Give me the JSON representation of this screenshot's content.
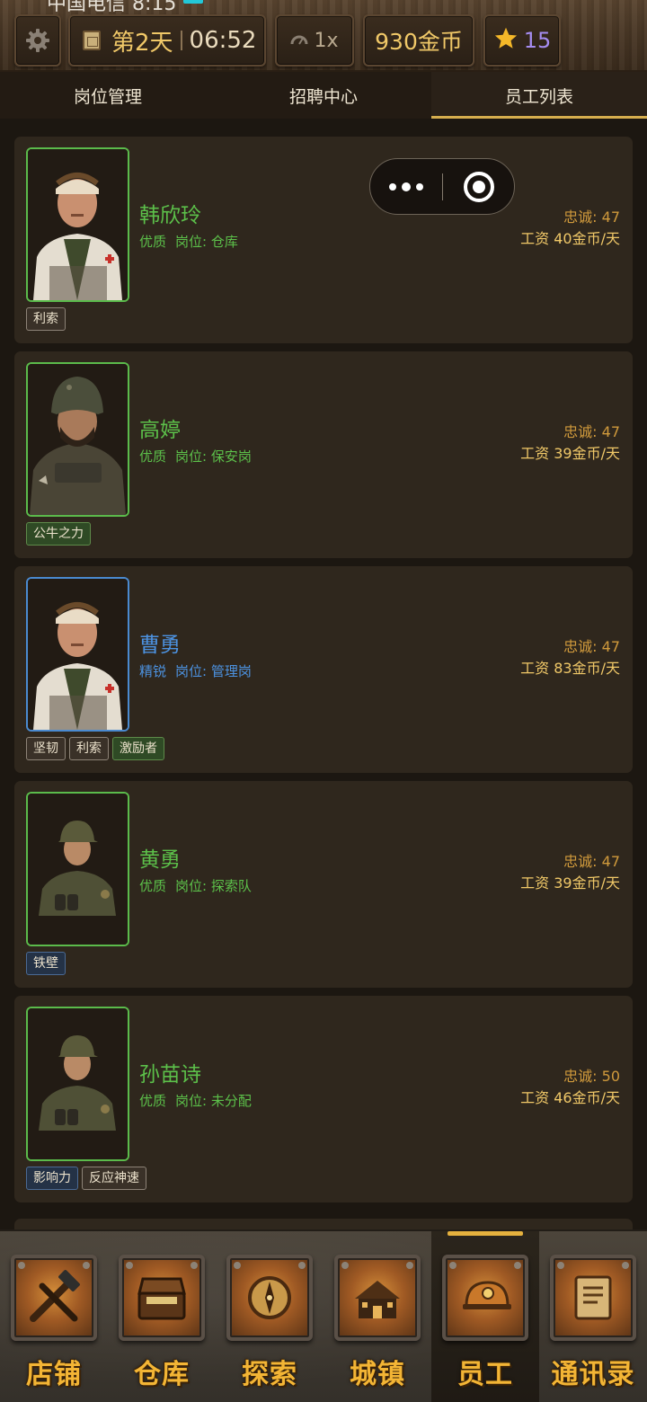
{
  "statusbar": {
    "carrier": "中国电信 8:15"
  },
  "hud": {
    "day": "第2天",
    "clock": "06:52",
    "speed": "1x",
    "gold": "930金币",
    "stars": "15"
  },
  "tabs": [
    {
      "label": "岗位管理",
      "active": false
    },
    {
      "label": "招聘中心",
      "active": false
    },
    {
      "label": "员工列表",
      "active": true
    }
  ],
  "employees": [
    {
      "name": "韩欣玲",
      "quality": "优质",
      "position": "岗位: 仓库",
      "loyalty": "忠诚: 47",
      "wage": "工资 40金币/天",
      "portrait": "medic-portrait",
      "tags": [
        "利索"
      ]
    },
    {
      "name": "高婷",
      "quality": "优质",
      "position": "岗位: 保安岗",
      "loyalty": "忠诚: 47",
      "wage": "工资 39金币/天",
      "portrait": "security-portrait",
      "tags": [
        "公牛之力"
      ]
    },
    {
      "name": "曹勇",
      "quality": "精锐",
      "position": "岗位: 管理岗",
      "loyalty": "忠诚: 47",
      "wage": "工资 83金币/天",
      "portrait": "medic-portrait",
      "tags": [
        "坚韧",
        "利索",
        "激励者"
      ]
    },
    {
      "name": "黄勇",
      "quality": "优质",
      "position": "岗位: 探索队",
      "loyalty": "忠诚: 47",
      "wage": "工资 39金币/天",
      "portrait": "soldier-portrait",
      "tags": [
        "铁壁"
      ]
    },
    {
      "name": "孙苗诗",
      "quality": "优质",
      "position": "岗位: 未分配",
      "loyalty": "忠诚: 50",
      "wage": "工资 46金币/天",
      "portrait": "soldier-portrait",
      "tags": [
        "影响力",
        "反应神速"
      ]
    }
  ],
  "nav": [
    {
      "label": "店铺",
      "icon": "shop-tools-icon",
      "active": false
    },
    {
      "label": "仓库",
      "icon": "treasure-chest-icon",
      "active": false
    },
    {
      "label": "探索",
      "icon": "compass-icon",
      "active": false
    },
    {
      "label": "城镇",
      "icon": "town-icon",
      "active": false
    },
    {
      "label": "员工",
      "icon": "miner-helmet-icon",
      "active": true
    },
    {
      "label": "通讯录",
      "icon": "address-book-icon",
      "active": false
    }
  ],
  "colors": {
    "accent": "#d6ae4e",
    "quality_good": "#5cc04a",
    "quality_elite": "#4c92e0",
    "loyalty": "#d09a3c",
    "wage": "#f0c868"
  }
}
